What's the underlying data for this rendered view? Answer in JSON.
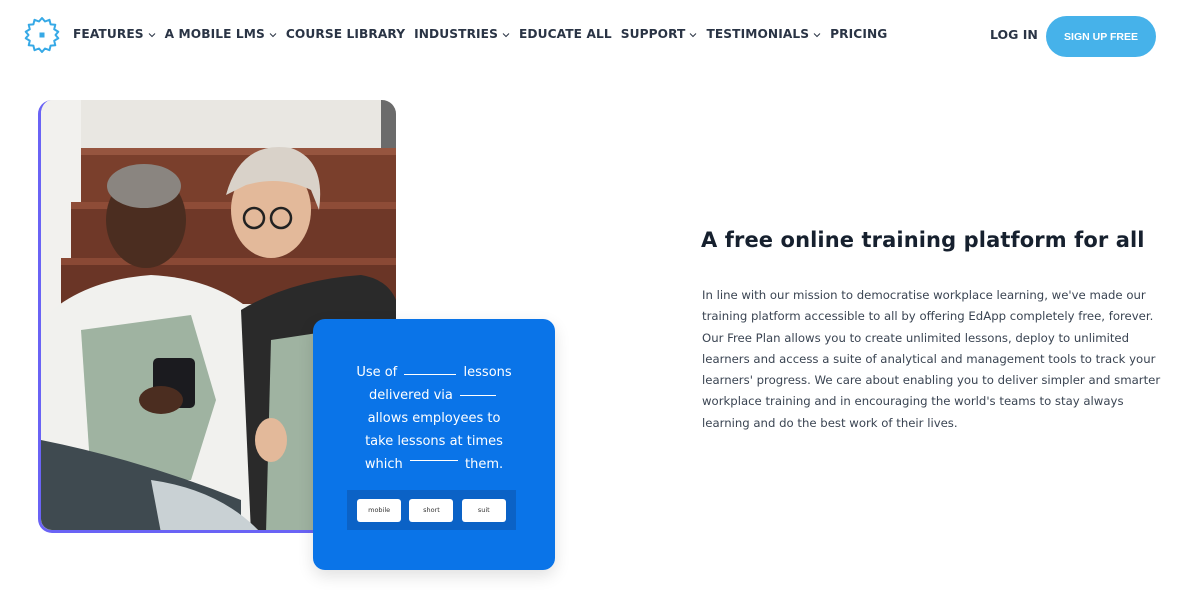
{
  "header": {
    "logo_icon": "gear-badge-icon",
    "nav": [
      {
        "label": "FEATURES",
        "dropdown": true
      },
      {
        "label": "A MOBILE LMS",
        "dropdown": true
      },
      {
        "label": "COURSE LIBRARY",
        "dropdown": false
      },
      {
        "label": "INDUSTRIES",
        "dropdown": true
      },
      {
        "label": "EDUCATE ALL",
        "dropdown": false
      },
      {
        "label": "SUPPORT",
        "dropdown": true
      },
      {
        "label": "TESTIMONIALS",
        "dropdown": true
      },
      {
        "label": "PRICING",
        "dropdown": false
      }
    ],
    "login_label": "LOG IN",
    "signup_label": "SIGN UP FREE"
  },
  "colors": {
    "brand_blue": "#46b2ea",
    "card_blue": "#0a74e8",
    "photo_border": "#6a63f5"
  },
  "hero": {
    "photo_alt": "Two women in aprons sitting on stairs looking at a phone",
    "quiz": {
      "line1_a": "Use of",
      "line1_b": "lessons",
      "line2": "delivered via",
      "line3": "allows employees to",
      "line4": "take lessons at times",
      "line5_a": "which",
      "line5_b": "them.",
      "options": [
        "mobile",
        "short",
        "suit"
      ]
    }
  },
  "content": {
    "headline": "A free online training platform for all",
    "paragraph": "In line with our mission to democratise workplace learning, we've made our training platform accessible to all by offering EdApp completely free, forever. Our Free Plan allows you to create unlimited lessons, deploy to unlimited learners and access a suite of analytical and management tools to track your learners' progress. We care about enabling you to deliver simpler and smarter workplace training and in encouraging the world's teams to stay always learning and do the best work of their lives."
  }
}
